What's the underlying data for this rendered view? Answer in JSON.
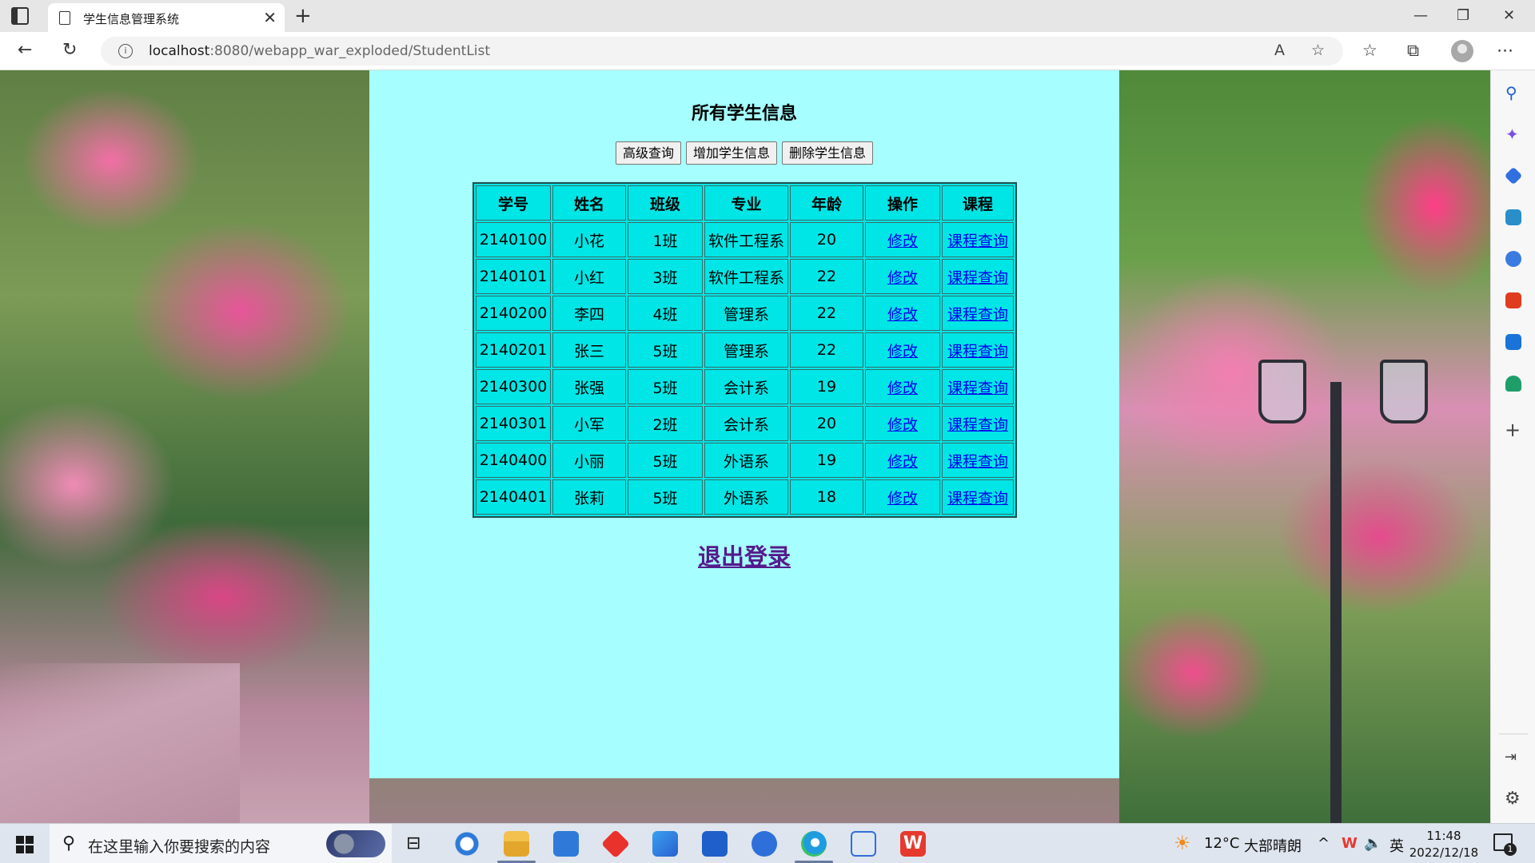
{
  "browser": {
    "tab_title": "学生信息管理系统",
    "url_host": "localhost",
    "url_rest": ":8080/webapp_war_exploded/StudentList"
  },
  "page": {
    "title": "所有学生信息",
    "buttons": {
      "advanced_query": "高级查询",
      "add_student": "增加学生信息",
      "delete_student": "删除学生信息"
    },
    "table": {
      "headers": [
        "学号",
        "姓名",
        "班级",
        "专业",
        "年龄",
        "操作",
        "课程"
      ],
      "rows": [
        {
          "id": "2140100",
          "name": "小花",
          "class": "1班",
          "major": "软件工程系",
          "age": "20",
          "edit": "修改",
          "course": "课程查询"
        },
        {
          "id": "2140101",
          "name": "小红",
          "class": "3班",
          "major": "软件工程系",
          "age": "22",
          "edit": "修改",
          "course": "课程查询"
        },
        {
          "id": "2140200",
          "name": "李四",
          "class": "4班",
          "major": "管理系",
          "age": "22",
          "edit": "修改",
          "course": "课程查询"
        },
        {
          "id": "2140201",
          "name": "张三",
          "class": "5班",
          "major": "管理系",
          "age": "22",
          "edit": "修改",
          "course": "课程查询"
        },
        {
          "id": "2140300",
          "name": "张强",
          "class": "5班",
          "major": "会计系",
          "age": "19",
          "edit": "修改",
          "course": "课程查询"
        },
        {
          "id": "2140301",
          "name": "小军",
          "class": "2班",
          "major": "会计系",
          "age": "20",
          "edit": "修改",
          "course": "课程查询"
        },
        {
          "id": "2140400",
          "name": "小丽",
          "class": "5班",
          "major": "外语系",
          "age": "19",
          "edit": "修改",
          "course": "课程查询"
        },
        {
          "id": "2140401",
          "name": "张莉",
          "class": "5班",
          "major": "外语系",
          "age": "18",
          "edit": "修改",
          "course": "课程查询"
        }
      ]
    },
    "logout": "退出登录"
  },
  "taskbar": {
    "search_placeholder": "在这里输入你要搜索的内容",
    "weather_temp": "12°C",
    "weather_desc": "大部晴朗",
    "ime_lang": "英",
    "time": "11:48",
    "date": "2022/12/18",
    "notification_count": "1"
  },
  "colors": {
    "panel_bg": "#a6fffe",
    "table_bg": "#00e6e6",
    "link": "#0000ee",
    "visited_link": "#551a8b"
  }
}
